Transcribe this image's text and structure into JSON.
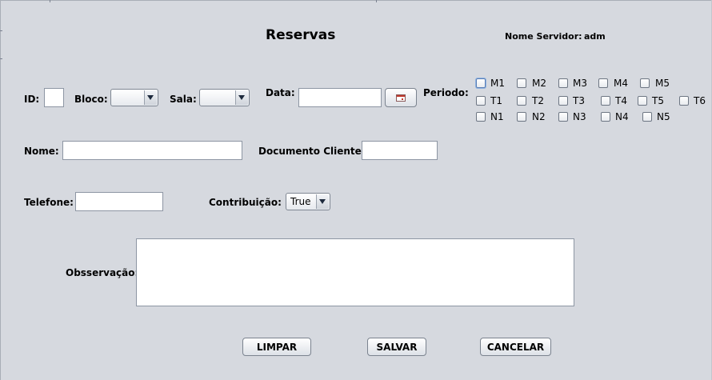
{
  "title": "Reservas",
  "servidor": {
    "label": "Nome Servidor:",
    "value": "adm"
  },
  "labels": {
    "id": "ID:",
    "bloco": "Bloco:",
    "sala": "Sala:",
    "data": "Data:",
    "periodo": "Periodo:",
    "nome": "Nome:",
    "documento": "Documento Cliente:",
    "telefone": "Telefone:",
    "contribuicao": "Contribuição:",
    "observacao": "Obsservação:"
  },
  "fields": {
    "id": "",
    "bloco": "",
    "sala": "",
    "data": "",
    "nome": "",
    "documento": "",
    "telefone": "",
    "observacao": ""
  },
  "contribuicao_selected": "True",
  "periodo": {
    "M": [
      "M1",
      "M2",
      "M3",
      "M4",
      "M5"
    ],
    "T": [
      "T1",
      "T2",
      "T3",
      "T4",
      "T5",
      "T6"
    ],
    "N": [
      "N1",
      "N2",
      "N3",
      "N4",
      "N5"
    ]
  },
  "buttons": {
    "limpar": "LIMPAR",
    "salvar": "SALVAR",
    "cancelar": "CANCELAR"
  },
  "icons": {
    "date_picker": "calendar-icon",
    "combo_arrow": "chevron-down-icon"
  },
  "colors": {
    "background": "#d6d9df",
    "field_border": "#8d96a3",
    "focus": "#8fb2e0"
  }
}
